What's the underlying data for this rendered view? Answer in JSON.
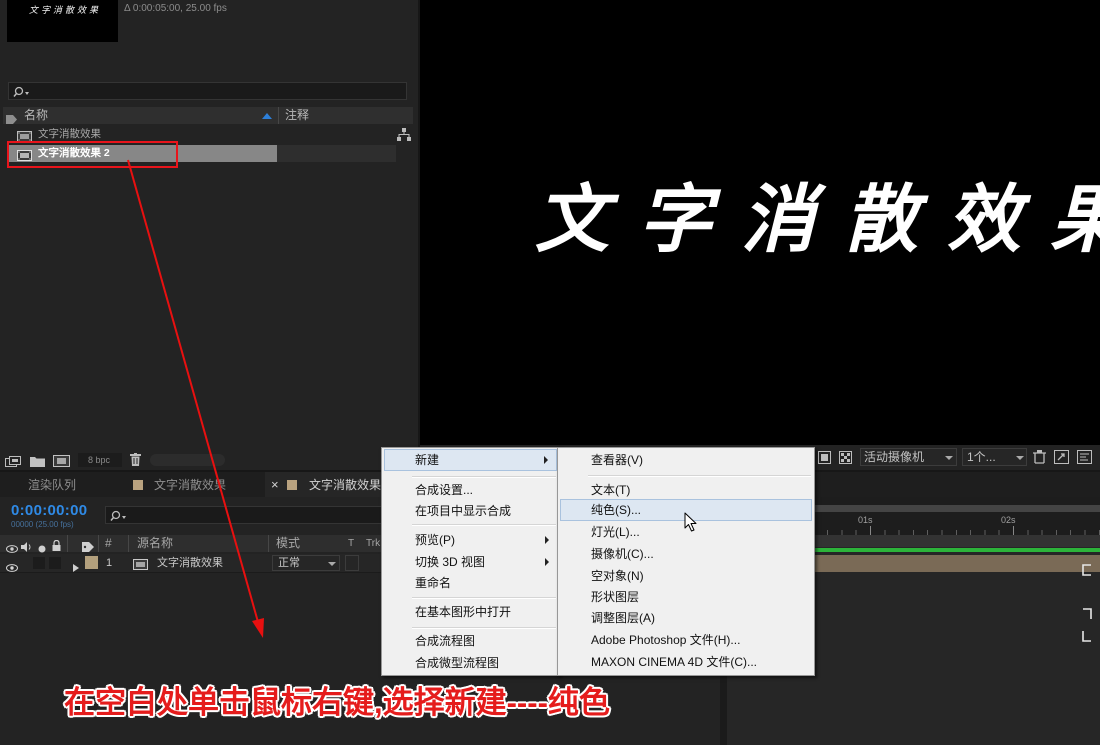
{
  "project_panel": {
    "thumbnail_text": "文字消散效果",
    "comp_info": "Δ 0:00:05:00, 25.00 fps",
    "columns": {
      "name": "名称",
      "comment": "注释"
    },
    "items": [
      {
        "name": "文字消散效果",
        "icon": "composition-icon",
        "selected": false
      },
      {
        "name": "文字消散效果 2",
        "icon": "composition-icon",
        "selected": true
      }
    ],
    "bpc": "8 bpc"
  },
  "viewer": {
    "preview_text": "文字消散效果",
    "toolbar": {
      "camera": "活动摄像机",
      "view_layout": "1个..."
    }
  },
  "timeline": {
    "tabs": [
      {
        "label": "渲染队列",
        "active": false
      },
      {
        "label": "文字消散效果",
        "label_color": "#b9a27f",
        "active": false
      },
      {
        "label": "文字消散效果",
        "label_color": "#b9a27f",
        "active": true,
        "close_glyph": "×"
      }
    ],
    "timecode": "0:00:00:00",
    "frame_info": "00000 (25.00 fps)",
    "columns": {
      "number": "#",
      "source_name": "源名称",
      "mode": "模式",
      "t": "T",
      "trkmat": "Trk"
    },
    "layers": [
      {
        "number": "1",
        "name": "文字消散效果",
        "mode": "正常",
        "label_color": "#b3a07d"
      }
    ],
    "ruler_labels": [
      "01s",
      "02s"
    ]
  },
  "context_menu": {
    "items": [
      {
        "label": "新建",
        "submenu": true,
        "highlighted": true
      },
      {
        "label": "合成设置..."
      },
      {
        "label": "在项目中显示合成"
      },
      {
        "label": "预览(P)",
        "submenu": true
      },
      {
        "label": "切换 3D 视图",
        "submenu": true
      },
      {
        "label": "重命名"
      },
      {
        "label": "在基本图形中打开"
      },
      {
        "label": "合成流程图"
      },
      {
        "label": "合成微型流程图"
      }
    ]
  },
  "new_submenu": {
    "items": [
      {
        "label": "查看器(V)"
      },
      {
        "label": "文本(T)"
      },
      {
        "label": "纯色(S)...",
        "highlighted": true
      },
      {
        "label": "灯光(L)..."
      },
      {
        "label": "摄像机(C)..."
      },
      {
        "label": "空对象(N)"
      },
      {
        "label": "形状图层"
      },
      {
        "label": "调整图层(A)"
      },
      {
        "label": "Adobe Photoshop 文件(H)..."
      },
      {
        "label": "MAXON CINEMA 4D 文件(C)..."
      }
    ]
  },
  "annotation": {
    "caption": "在空白处单击鼠标右键,选择新建----纯色",
    "caption_color": "#e51c1c",
    "arrow_color": "#e81010",
    "highlight_box_color": "#e8141b"
  },
  "theme": {
    "timecode_color": "#2f8ae6",
    "layer_bar_color": "#7a6a56",
    "timeline_green": "#2cb43a",
    "menu_highlight": "#dde7f2"
  }
}
